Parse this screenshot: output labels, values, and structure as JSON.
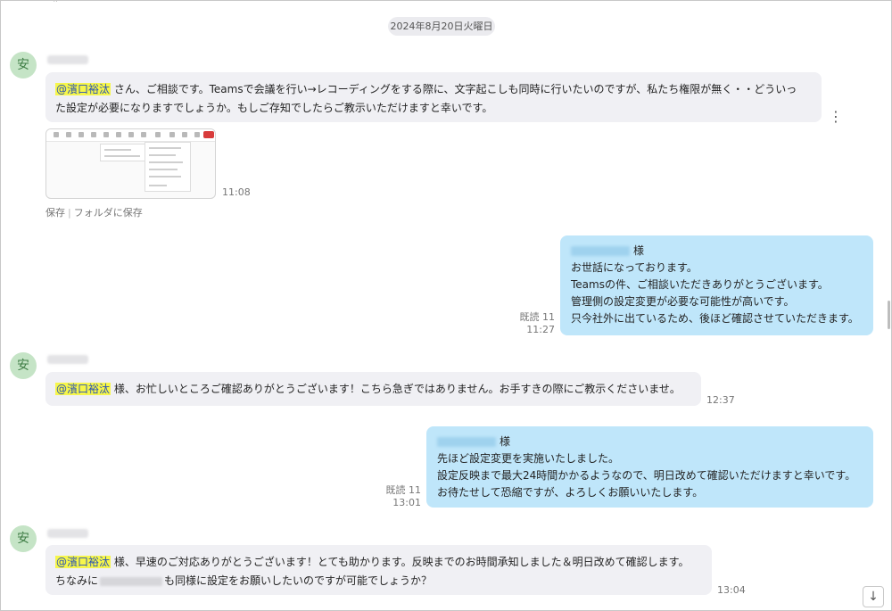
{
  "chat": {
    "date_separator": "2024年8月20日火曜日",
    "top_fragment": "ᵂ",
    "messages": [
      {
        "direction": "in",
        "avatar": "安",
        "mention": "@濱口裕汰",
        "line1": " さん、ご相談です。Teamsで会議を行い→レコーディングをする際に、文字起こしも同時に行いたいのですが、私たち権限が無く・・どういっ",
        "line2": "た設定が必要になりますでしょうか。もしご存知でしたらご教示いただけますと幸いです。",
        "attachment_time": "11:08",
        "save_label": "保存",
        "save_separator": "|",
        "save_folder_label": "フォルダに保存"
      },
      {
        "direction": "out",
        "honorific": "様",
        "lines": [
          "お世話になっております。",
          "Teamsの件、ご相談いただきありがとうございます。",
          "管理側の設定変更が必要な可能性が高いです。",
          "只今社外に出ているため、後ほど確認させていただきます。"
        ],
        "read_status": "既読 11",
        "time": "11:27"
      },
      {
        "direction": "in",
        "avatar": "安",
        "mention": "@濱口裕汰",
        "text": " 様、お忙しいところご確認ありがとうございます！こちら急ぎではありません。お手すきの際にご教示くださいませ。",
        "time": "12:37"
      },
      {
        "direction": "out",
        "honorific": "様",
        "lines": [
          "先ほど設定変更を実施いたしました。",
          "設定反映まで最大24時間かかるようなので、明日改めて確認いただけますと幸いです。",
          "お待たせして恐縮ですが、よろしくお願いいたします。"
        ],
        "read_status": "既読 11",
        "time": "13:01"
      },
      {
        "direction": "in",
        "avatar": "安",
        "mention": "@濱口裕汰",
        "line1": " 様、早速のご対応ありがとうございます！とても助かります。反映までのお時間承知しました＆明日改めて確認します。",
        "line2_prefix": "ちなみに",
        "line2_suffix": "も同様に設定をお願いしたいのですが可能でしょうか？",
        "time": "13:04"
      }
    ]
  },
  "icons": {
    "more": "more-options-icon",
    "jump": "arrow-down-icon"
  },
  "colors": {
    "incoming_bubble": "#f0f0f4",
    "outgoing_bubble": "#bfe6fa",
    "mention_highlight": "#f6f64a",
    "mention_text": "#2b53b5",
    "avatar_bg": "#c5e4c6",
    "avatar_text": "#3f7d45"
  }
}
